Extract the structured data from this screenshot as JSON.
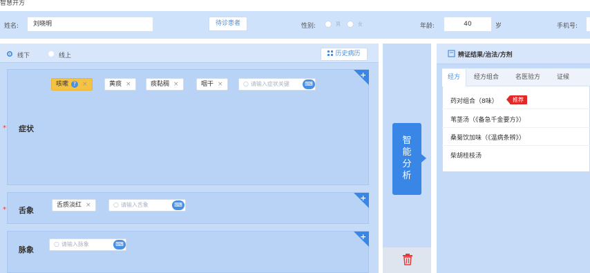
{
  "app": {
    "title": "智慧开方"
  },
  "patient": {
    "name_label": "姓名:",
    "name_value": "刘晓明",
    "visit_type_button": "待诊患者",
    "gender_label": "性别:",
    "gender_options": [
      "男",
      "女"
    ],
    "age_label": "年龄:",
    "age_value": "40",
    "age_unit": "岁",
    "phone_label": "手机号:"
  },
  "mode": {
    "options": [
      "线下",
      "线上"
    ],
    "selected": "线下",
    "history_button": "历史病历"
  },
  "sections": {
    "symptoms": {
      "label": "症状",
      "required_mark": "*",
      "tags": [
        {
          "text": "咳嗽",
          "highlight": true,
          "has_help": true,
          "help_glyph": "?"
        },
        {
          "text": "黄痰",
          "highlight": false
        },
        {
          "text": "痰黏稠",
          "highlight": false
        },
        {
          "text": "咽干",
          "highlight": false
        }
      ],
      "close_glyph": "×",
      "search_placeholder": "请输入症状关键"
    },
    "tongue": {
      "label": "舌象",
      "required_mark": "*",
      "tags": [
        {
          "text": "舌质淡红"
        }
      ],
      "search_placeholder": "请输入舌象"
    },
    "pulse": {
      "label": "脉象",
      "search_placeholder": "请输入脉象"
    },
    "add_glyph": "+"
  },
  "analyze": {
    "label_chars": [
      "智",
      "能",
      "分",
      "析"
    ]
  },
  "results": {
    "title": "辨证结果/治法/方剂",
    "tabs": [
      "经方",
      "经方组合",
      "名医验方",
      "证候"
    ],
    "active_tab": "经方",
    "items": [
      {
        "text": "药对组合（8味）",
        "badge": "推荐"
      },
      {
        "text": "苇茎汤（《备急千金要方》）"
      },
      {
        "text": "桑菊饮加味（《温病条辨》）"
      },
      {
        "text": "柴胡桂枝汤"
      }
    ]
  },
  "icons": {
    "search": "search-icon",
    "keyboard": "keyboard-icon",
    "grid": "grid-icon",
    "trash": "trash-icon",
    "book": "book-icon"
  },
  "colors": {
    "accent": "#3a86e6",
    "panel": "#c6dbf8",
    "section": "#b9d3f6",
    "highlight_tag": "#f5c246",
    "badge": "#e02a2a",
    "trash": "#e53935"
  }
}
